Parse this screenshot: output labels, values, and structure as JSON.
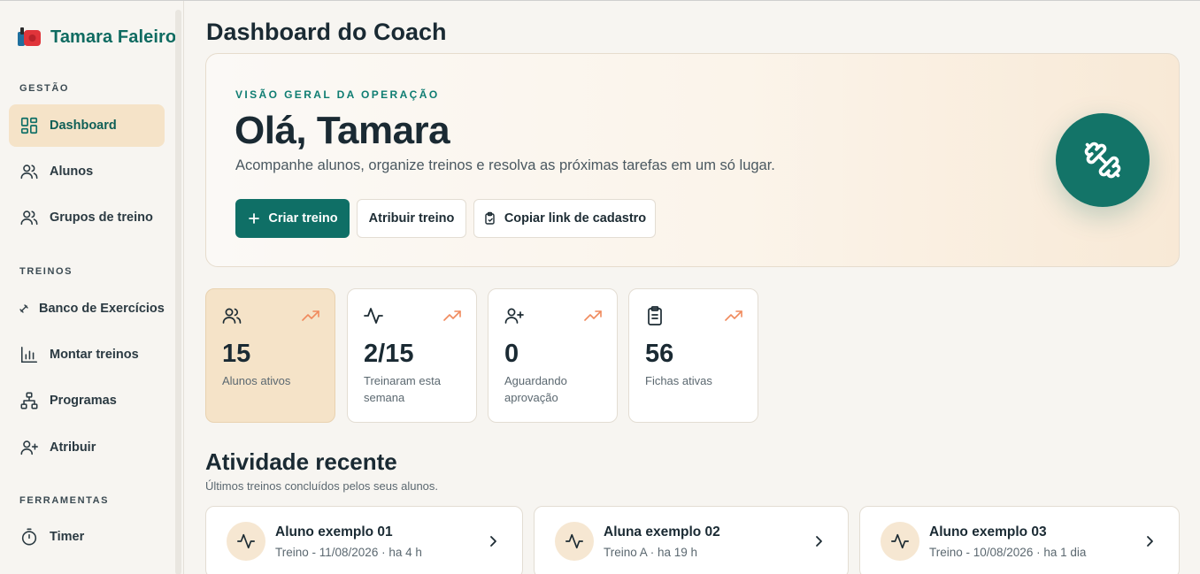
{
  "brand": {
    "name": "Tamara Faleiro"
  },
  "sidebar": {
    "sections": [
      {
        "title": "GESTÃO"
      },
      {
        "title": "TREINOS"
      },
      {
        "title": "FERRAMENTAS"
      }
    ],
    "items": [
      {
        "label": "Dashboard",
        "icon": "dashboard-icon",
        "active": true
      },
      {
        "label": "Alunos",
        "icon": "users-icon"
      },
      {
        "label": "Grupos de treino",
        "icon": "group-icon"
      },
      {
        "label": "Banco de Exercícios",
        "icon": "dumbbell-icon"
      },
      {
        "label": "Montar treinos",
        "icon": "bar-chart-icon"
      },
      {
        "label": "Programas",
        "icon": "hierarchy-icon"
      },
      {
        "label": "Atribuir",
        "icon": "user-plus-icon"
      },
      {
        "label": "Timer",
        "icon": "timer-icon"
      }
    ]
  },
  "header": {
    "title": "Dashboard do Coach"
  },
  "hero": {
    "kicker": "VISÃO GERAL DA OPERAÇÃO",
    "title": "Olá, Tamara",
    "subtitle": "Acompanhe alunos, organize treinos e resolva as próximas tarefas em um só lugar.",
    "buttons": {
      "create": "Criar treino",
      "assign": "Atribuir treino",
      "copy_link": "Copiar link de cadastro"
    },
    "badge_icon": "dumbbell-icon"
  },
  "stats": [
    {
      "value": "15",
      "label": "Alunos ativos",
      "icon": "users-icon"
    },
    {
      "value": "2/15",
      "label": "Treinaram esta semana",
      "icon": "activity-icon"
    },
    {
      "value": "0",
      "label": "Aguardando aprovação",
      "icon": "user-plus-icon"
    },
    {
      "value": "56",
      "label": "Fichas ativas",
      "icon": "clipboard-icon"
    }
  ],
  "activity": {
    "title": "Atividade recente",
    "subtitle": "Últimos treinos concluídos pelos seus alunos.",
    "items": [
      {
        "name": "Aluno exemplo 01",
        "meta": "Treino - 11/08/2026 · ha 4 h"
      },
      {
        "name": "Aluna exemplo 02",
        "meta": "Treino A · ha 19 h"
      },
      {
        "name": "Aluno exemplo 03",
        "meta": "Treino - 10/08/2026 · ha 1 dia"
      }
    ]
  },
  "colors": {
    "primary": "#0f6f66",
    "accent_bg": "#f5e3c8",
    "trend": "#f08a5d",
    "background": "#f7f5f1"
  }
}
